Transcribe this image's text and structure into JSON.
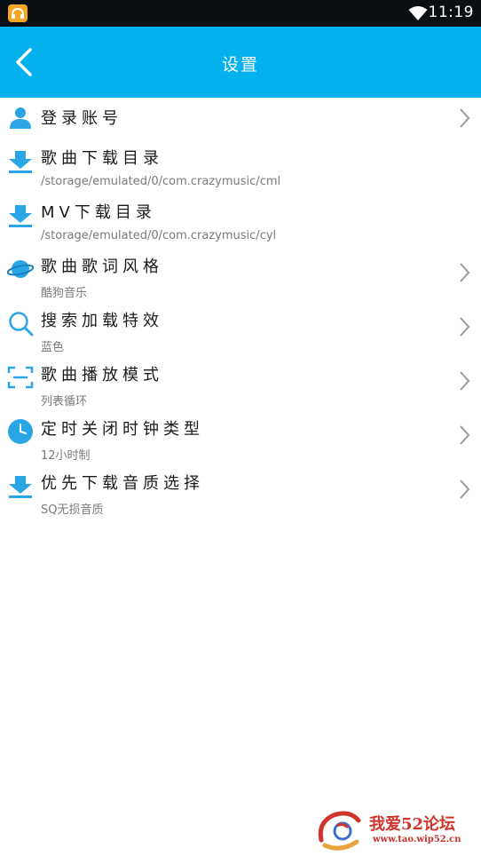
{
  "status_bar": {
    "time": "11:19",
    "app_icon": "music-app-icon",
    "wifi_icon": "wifi-icon"
  },
  "header": {
    "title": "设置",
    "back_icon": "back-arrow-icon",
    "background_color": "#03b2ec"
  },
  "settings": [
    {
      "title": "登录账号",
      "subtitle": "",
      "icon": "user-icon",
      "has_chevron": true
    },
    {
      "title": "歌曲下载目录",
      "subtitle": "/storage/emulated/0/com.crazymusic/cml",
      "icon": "download-icon",
      "has_chevron": false
    },
    {
      "title": "MV下载目录",
      "subtitle": "/storage/emulated/0/com.crazymusic/cyl",
      "icon": "download-icon",
      "has_chevron": false
    },
    {
      "title": "歌曲歌词风格",
      "subtitle": "酷狗音乐",
      "icon": "planet-icon",
      "has_chevron": true
    },
    {
      "title": "搜索加载特效",
      "subtitle": "蓝色",
      "icon": "search-icon",
      "has_chevron": true
    },
    {
      "title": "歌曲播放模式",
      "subtitle": "列表循环",
      "icon": "scan-frame-icon",
      "has_chevron": true
    },
    {
      "title": "定时关闭时钟类型",
      "subtitle": "12小时制",
      "icon": "clock-icon",
      "has_chevron": true
    },
    {
      "title": "优先下载音质选择",
      "subtitle": "SQ无损音质",
      "icon": "download-icon",
      "has_chevron": true
    }
  ],
  "watermark": {
    "title": "我爱52论坛",
    "url": "www.tao.wip52.cn"
  },
  "colors": {
    "accent": "#03b2ec",
    "icon_blue": "#2aa6e6",
    "text_primary": "#1a1a1a",
    "text_secondary": "#7a7a7a"
  }
}
